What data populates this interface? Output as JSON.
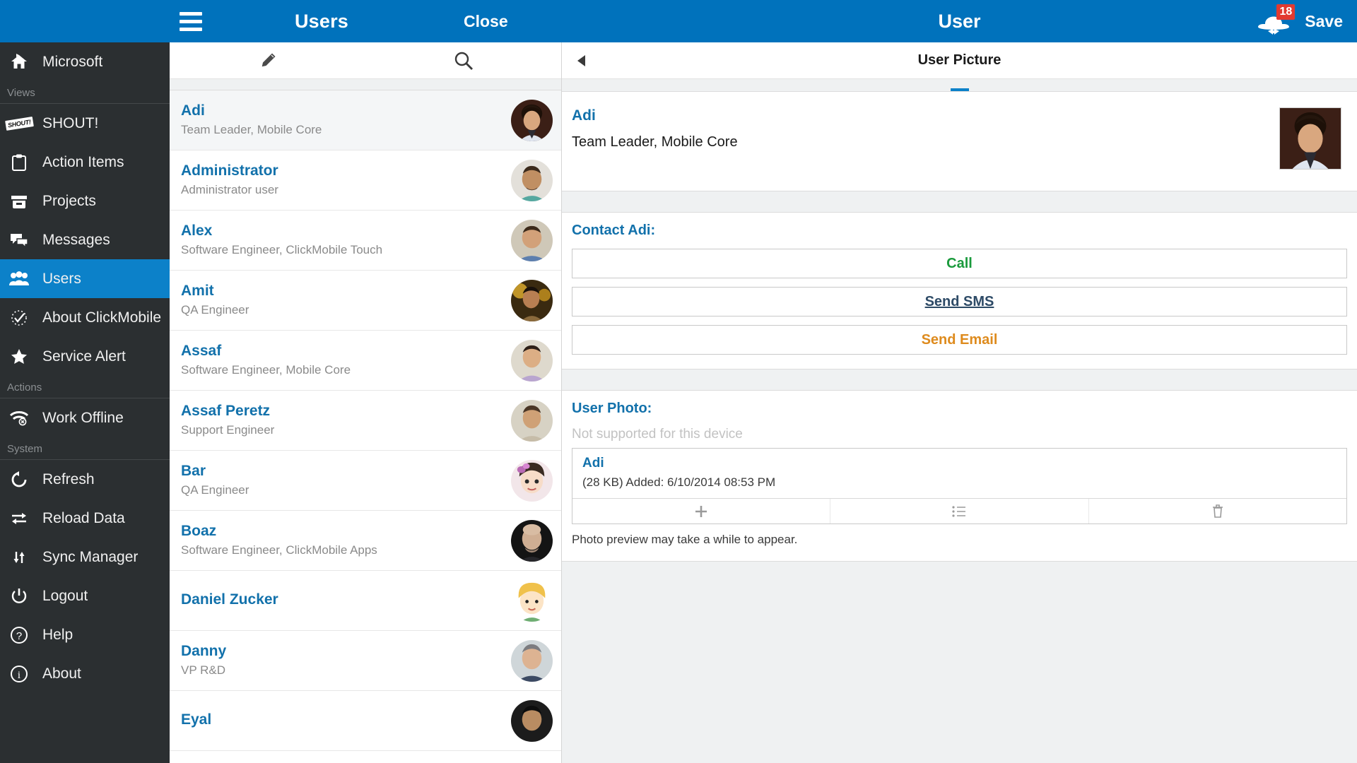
{
  "topbar": {
    "menu_icon": "hamburger-icon",
    "list_title": "Users",
    "close_label": "Close",
    "detail_title": "User",
    "notification_icon": "shout-hat-icon",
    "notification_count": "18",
    "save_label": "Save"
  },
  "sidebar": {
    "home": {
      "label": "Microsoft",
      "icon": "home-icon"
    },
    "group_views": "Views",
    "group_actions": "Actions",
    "group_system": "System",
    "views": [
      {
        "label": "SHOUT!",
        "icon": "shout-tag-icon",
        "active": false
      },
      {
        "label": "Action Items",
        "icon": "clipboard-icon",
        "active": false
      },
      {
        "label": "Projects",
        "icon": "archive-box-icon",
        "active": false
      },
      {
        "label": "Messages",
        "icon": "chat-bubbles-icon",
        "active": false
      },
      {
        "label": "Users",
        "icon": "users-group-icon",
        "active": true
      },
      {
        "label": "About ClickMobile",
        "icon": "check-clock-icon",
        "active": false
      },
      {
        "label": "Service Alert",
        "icon": "star-icon",
        "active": false
      }
    ],
    "actions": [
      {
        "label": "Work Offline",
        "icon": "wifi-off-icon"
      }
    ],
    "system": [
      {
        "label": "Refresh",
        "icon": "refresh-icon"
      },
      {
        "label": "Reload Data",
        "icon": "reload-arrows-icon"
      },
      {
        "label": "Sync Manager",
        "icon": "sync-updown-icon"
      },
      {
        "label": "Logout",
        "icon": "power-icon"
      },
      {
        "label": "Help",
        "icon": "question-circle-icon"
      },
      {
        "label": "About",
        "icon": "info-circle-icon"
      }
    ]
  },
  "list": {
    "toolbar": {
      "edit_icon": "pencil-icon",
      "search_icon": "search-icon"
    },
    "users": [
      {
        "name": "Adi",
        "role": "Team Leader, Mobile Core",
        "selected": true,
        "avatar": "photo-adi"
      },
      {
        "name": "Administrator",
        "role": "Administrator user",
        "selected": false,
        "avatar": "photo-administrator"
      },
      {
        "name": "Alex",
        "role": "Software Engineer, ClickMobile Touch",
        "selected": false,
        "avatar": "photo-alex"
      },
      {
        "name": "Amit",
        "role": "QA Engineer",
        "selected": false,
        "avatar": "photo-amit"
      },
      {
        "name": "Assaf",
        "role": "Software Engineer, Mobile Core",
        "selected": false,
        "avatar": "photo-assaf"
      },
      {
        "name": "Assaf Peretz",
        "role": "Support Engineer",
        "selected": false,
        "avatar": "photo-assaf-peretz"
      },
      {
        "name": "Bar",
        "role": "QA Engineer",
        "selected": false,
        "avatar": "photo-bar"
      },
      {
        "name": "Boaz",
        "role": "Software Engineer, ClickMobile Apps",
        "selected": false,
        "avatar": "photo-boaz"
      },
      {
        "name": "Daniel Zucker",
        "role": "",
        "selected": false,
        "avatar": "photo-daniel-zucker"
      },
      {
        "name": "Danny",
        "role": "VP R&D",
        "selected": false,
        "avatar": "photo-danny"
      },
      {
        "name": "Eyal",
        "role": "",
        "selected": false,
        "avatar": "photo-eyal"
      }
    ]
  },
  "detail": {
    "toolbar": {
      "back_icon": "back-triangle-icon",
      "title": "User Picture"
    },
    "header": {
      "name": "Adi",
      "role": "Team Leader, Mobile Core",
      "photo": "photo-adi-large"
    },
    "contact": {
      "title": "Contact Adi:",
      "buttons": [
        {
          "label": "Call",
          "style": "call"
        },
        {
          "label": "Send SMS",
          "style": "sms"
        },
        {
          "label": "Send Email",
          "style": "email"
        }
      ]
    },
    "photo_section": {
      "title": "User Photo:",
      "not_supported": "Not supported for this device",
      "attachment": {
        "name": "Adi",
        "meta": "(28 KB) Added: 6/10/2014 08:53 PM",
        "actions": [
          {
            "icon": "plus-icon"
          },
          {
            "icon": "list-icon"
          },
          {
            "icon": "trash-icon"
          }
        ]
      },
      "hint": "Photo preview may take a while to appear."
    }
  },
  "colors": {
    "brand_blue": "#0072bc",
    "sidebar_bg": "#2b2f31",
    "active_blue": "#0c81c9",
    "link_blue": "#1271ab",
    "call_green": "#1a9a3c",
    "sms_navy": "#2d4a66",
    "email_orange": "#de8b1e",
    "badge_red": "#e23a30"
  }
}
